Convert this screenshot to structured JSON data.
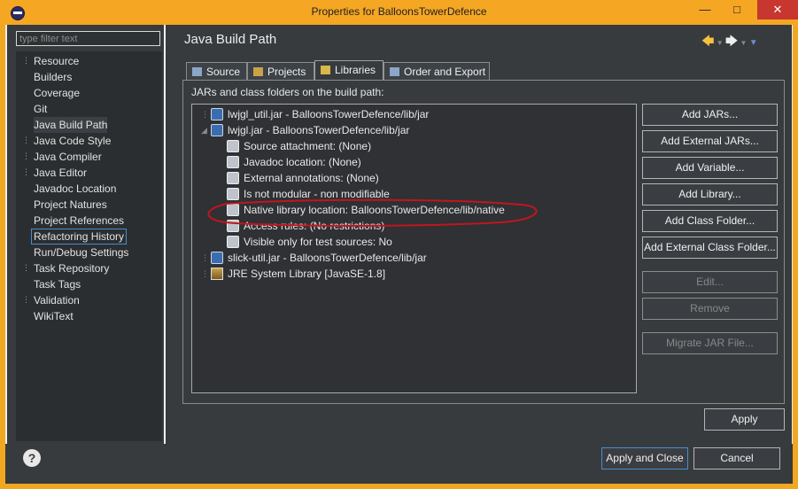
{
  "window": {
    "title": "Properties for BalloonsTowerDefence",
    "close_symbol": "✕"
  },
  "filter": {
    "placeholder": "type filter text"
  },
  "nav": {
    "items": [
      {
        "label": "Resource",
        "expandable": true
      },
      {
        "label": "Builders",
        "expandable": false
      },
      {
        "label": "Coverage",
        "expandable": false
      },
      {
        "label": "Git",
        "expandable": false
      },
      {
        "label": "Java Build Path",
        "expandable": false,
        "selected": true
      },
      {
        "label": "Java Code Style",
        "expandable": true
      },
      {
        "label": "Java Compiler",
        "expandable": true
      },
      {
        "label": "Java Editor",
        "expandable": true
      },
      {
        "label": "Javadoc Location",
        "expandable": false
      },
      {
        "label": "Project Natures",
        "expandable": false
      },
      {
        "label": "Project References",
        "expandable": false
      },
      {
        "label": "Refactoring History",
        "expandable": false,
        "focused": true
      },
      {
        "label": "Run/Debug Settings",
        "expandable": false
      },
      {
        "label": "Task Repository",
        "expandable": true
      },
      {
        "label": "Task Tags",
        "expandable": false
      },
      {
        "label": "Validation",
        "expandable": true
      },
      {
        "label": "WikiText",
        "expandable": false
      }
    ]
  },
  "page": {
    "title": "Java Build Path",
    "back_icon": "arrow-left-icon",
    "forward_icon": "arrow-right-icon",
    "menu_icon": "chevron-down-icon"
  },
  "tabs": [
    {
      "label": "Source",
      "icon": "source-folder-icon"
    },
    {
      "label": "Projects",
      "icon": "projects-icon"
    },
    {
      "label": "Libraries",
      "icon": "libraries-icon",
      "active": true
    },
    {
      "label": "Order and Export",
      "icon": "order-export-icon"
    }
  ],
  "libraries": {
    "label": "JARs and class folders on the build path:",
    "rows": [
      {
        "text": "lwjgl_util.jar - BalloonsTowerDefence/lib/jar",
        "icon": "jar-icon",
        "level": 0,
        "expand": "collapsed"
      },
      {
        "text": "lwjgl.jar - BalloonsTowerDefence/lib/jar",
        "icon": "jar-icon",
        "level": 0,
        "expand": "expanded"
      },
      {
        "text": "Source attachment: (None)",
        "icon": "source-attachment-icon",
        "level": 1
      },
      {
        "text": "Javadoc location: (None)",
        "icon": "javadoc-icon",
        "level": 1
      },
      {
        "text": "External annotations: (None)",
        "icon": "annotations-icon",
        "level": 1
      },
      {
        "text": "Is not modular - non modifiable",
        "icon": "module-icon",
        "level": 1
      },
      {
        "text": "Native library location: BalloonsTowerDefence/lib/native",
        "icon": "native-library-icon",
        "level": 1,
        "highlighted": true
      },
      {
        "text": "Access rules: (No restrictions)",
        "icon": "access-rules-icon",
        "level": 1
      },
      {
        "text": "Visible only for test sources: No",
        "icon": "test-sources-icon",
        "level": 1
      },
      {
        "text": "slick-util.jar - BalloonsTowerDefence/lib/jar",
        "icon": "jar-icon",
        "level": 0,
        "expand": "collapsed"
      },
      {
        "text": "JRE System Library [JavaSE-1.8]",
        "icon": "library-icon",
        "level": 0,
        "expand": "collapsed"
      }
    ]
  },
  "buttons": {
    "add_jars": "Add JARs...",
    "add_external_jars": "Add External JARs...",
    "add_variable": "Add Variable...",
    "add_library": "Add Library...",
    "add_class_folder": "Add Class Folder...",
    "add_external_class_folder": "Add External Class Folder...",
    "edit": "Edit...",
    "remove": "Remove",
    "migrate_jar": "Migrate JAR File...",
    "apply": "Apply",
    "apply_close": "Apply and Close",
    "cancel": "Cancel"
  },
  "help": {
    "symbol": "?"
  },
  "colors": {
    "accent": "#f5a623",
    "panel": "#373b3e",
    "annotation": "#c0161e"
  }
}
